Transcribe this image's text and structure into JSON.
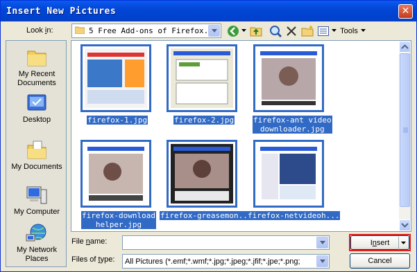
{
  "window": {
    "title": "Insert New Pictures",
    "close_glyph": "✕"
  },
  "toolbar": {
    "lookin_label_pre": "Look ",
    "lookin_label_accel": "i",
    "lookin_label_post": "n:",
    "lookin_value": "5 Free Add-ons of Firefox...",
    "tools_label": "Tools",
    "icons": [
      "back-icon",
      "up-folder-icon",
      "search-web-icon",
      "delete-icon",
      "new-folder-icon",
      "views-icon"
    ]
  },
  "places": [
    {
      "id": "recent",
      "line1": "My Recent",
      "line2": "Documents",
      "icon": "recent-documents-icon"
    },
    {
      "id": "desktop",
      "line1": "Desktop",
      "line2": "",
      "icon": "desktop-icon"
    },
    {
      "id": "mydocs",
      "line1": "My Documents",
      "line2": "",
      "icon": "my-documents-icon"
    },
    {
      "id": "computer",
      "line1": "My Computer",
      "line2": "",
      "icon": "my-computer-icon"
    },
    {
      "id": "network",
      "line1": "My Network",
      "line2": "Places",
      "icon": "network-places-icon"
    }
  ],
  "files": [
    {
      "line1": "firefox-1.jpg",
      "line2": ""
    },
    {
      "line1": "firefox-2.jpg",
      "line2": ""
    },
    {
      "line1": "firefox-ant video",
      "line2": "downloader.jpg"
    },
    {
      "line1": "firefox-download",
      "line2": "helper.jpg"
    },
    {
      "line1": "firefox-greasemon...",
      "line2": ""
    },
    {
      "line1": "firefox-netvideoh...",
      "line2": ""
    }
  ],
  "form": {
    "filename_label_pre": "File ",
    "filename_label_accel": "n",
    "filename_label_post": "ame:",
    "filename_value": "",
    "filetype_label_pre": "Files of ",
    "filetype_label_accel": "t",
    "filetype_label_post": "ype:",
    "filetype_value": "All Pictures (*.emf;*.wmf;*.jpg;*.jpeg;*.jfif;*.jpe;*.png;"
  },
  "buttons": {
    "insert_pre": "I",
    "insert_accel": "n",
    "insert_post": "sert",
    "cancel": "Cancel"
  },
  "colors": {
    "selection": "#316ac5",
    "title_bar": "#0346d5",
    "highlight_border": "#e02020"
  }
}
